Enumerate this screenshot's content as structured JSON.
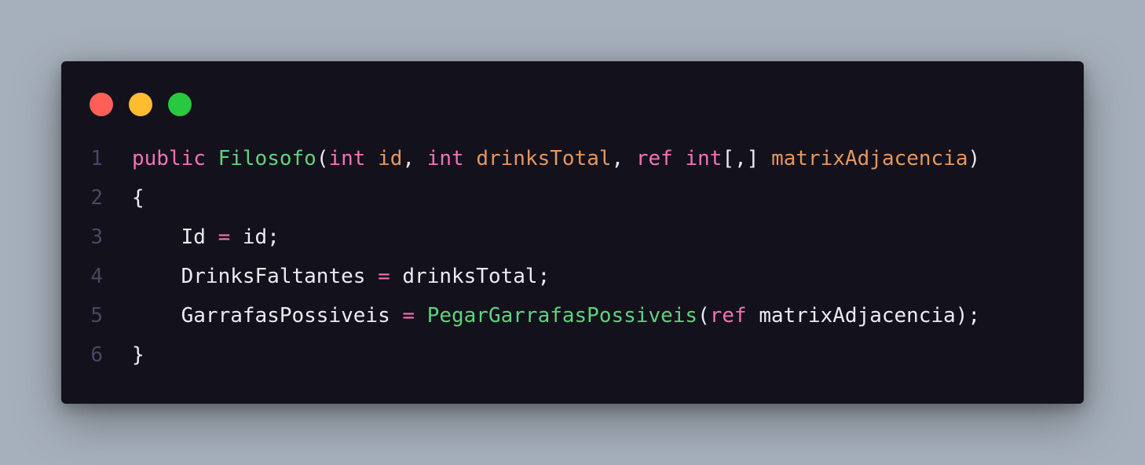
{
  "window": {
    "controls": [
      {
        "name": "close",
        "color": "#ff5f57"
      },
      {
        "name": "minimize",
        "color": "#febc2e"
      },
      {
        "name": "maximize",
        "color": "#28c840"
      }
    ]
  },
  "colors": {
    "background": "#a6b0bb",
    "editor_background": "#13111c",
    "keyword": "#f472b6",
    "function": "#5fd37d",
    "parameter": "#e5975f",
    "text": "#ecebf3",
    "line_number": "#4a4663"
  },
  "code": {
    "lines": [
      {
        "number": "1",
        "tokens": [
          {
            "text": "public",
            "kind": "kw"
          },
          {
            "text": " ",
            "kind": "plain"
          },
          {
            "text": "Filosofo",
            "kind": "fn"
          },
          {
            "text": "(",
            "kind": "plain"
          },
          {
            "text": "int",
            "kind": "kw"
          },
          {
            "text": " ",
            "kind": "plain"
          },
          {
            "text": "id",
            "kind": "param"
          },
          {
            "text": ", ",
            "kind": "plain"
          },
          {
            "text": "int",
            "kind": "kw"
          },
          {
            "text": " ",
            "kind": "plain"
          },
          {
            "text": "drinksTotal",
            "kind": "param"
          },
          {
            "text": ", ",
            "kind": "plain"
          },
          {
            "text": "ref",
            "kind": "kw"
          },
          {
            "text": " ",
            "kind": "plain"
          },
          {
            "text": "int",
            "kind": "kw"
          },
          {
            "text": "[,] ",
            "kind": "plain"
          },
          {
            "text": "matrixAdjacencia",
            "kind": "param"
          },
          {
            "text": ")",
            "kind": "plain"
          }
        ]
      },
      {
        "number": "2",
        "tokens": [
          {
            "text": "{",
            "kind": "plain"
          }
        ]
      },
      {
        "number": "3",
        "tokens": [
          {
            "text": "    Id ",
            "kind": "plain"
          },
          {
            "text": "=",
            "kind": "op"
          },
          {
            "text": " id;",
            "kind": "plain"
          }
        ]
      },
      {
        "number": "4",
        "tokens": [
          {
            "text": "    DrinksFaltantes ",
            "kind": "plain"
          },
          {
            "text": "=",
            "kind": "op"
          },
          {
            "text": " drinksTotal;",
            "kind": "plain"
          }
        ]
      },
      {
        "number": "5",
        "tokens": [
          {
            "text": "    GarrafasPossiveis ",
            "kind": "plain"
          },
          {
            "text": "=",
            "kind": "op"
          },
          {
            "text": " ",
            "kind": "plain"
          },
          {
            "text": "PegarGarrafasPossiveis",
            "kind": "fn"
          },
          {
            "text": "(",
            "kind": "plain"
          },
          {
            "text": "ref",
            "kind": "kw"
          },
          {
            "text": " matrixAdjacencia);",
            "kind": "plain"
          }
        ]
      },
      {
        "number": "6",
        "tokens": [
          {
            "text": "}",
            "kind": "plain"
          }
        ]
      }
    ]
  }
}
